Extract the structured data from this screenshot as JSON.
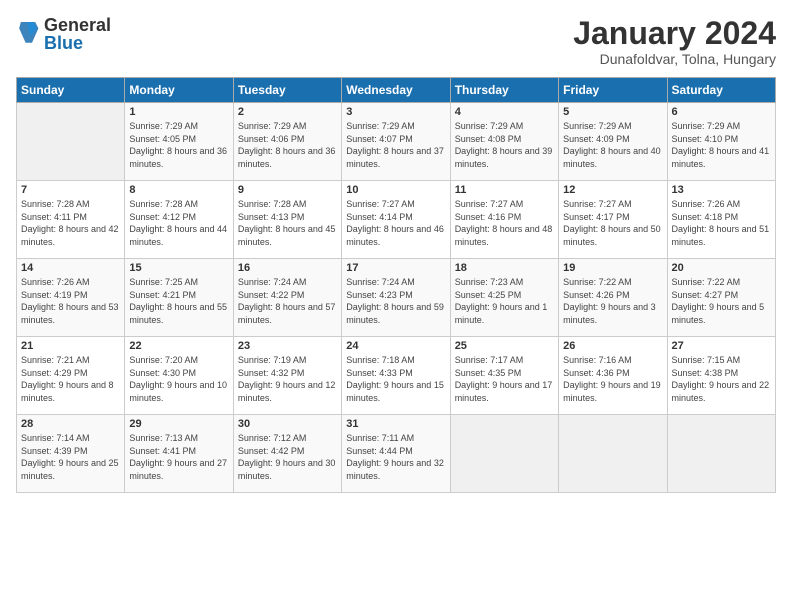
{
  "header": {
    "logo_general": "General",
    "logo_blue": "Blue",
    "month_title": "January 2024",
    "subtitle": "Dunafoldvar, Tolna, Hungary"
  },
  "weekdays": [
    "Sunday",
    "Monday",
    "Tuesday",
    "Wednesday",
    "Thursday",
    "Friday",
    "Saturday"
  ],
  "weeks": [
    [
      {
        "day": "",
        "sunrise": "",
        "sunset": "",
        "daylight": ""
      },
      {
        "day": "1",
        "sunrise": "Sunrise: 7:29 AM",
        "sunset": "Sunset: 4:05 PM",
        "daylight": "Daylight: 8 hours and 36 minutes."
      },
      {
        "day": "2",
        "sunrise": "Sunrise: 7:29 AM",
        "sunset": "Sunset: 4:06 PM",
        "daylight": "Daylight: 8 hours and 36 minutes."
      },
      {
        "day": "3",
        "sunrise": "Sunrise: 7:29 AM",
        "sunset": "Sunset: 4:07 PM",
        "daylight": "Daylight: 8 hours and 37 minutes."
      },
      {
        "day": "4",
        "sunrise": "Sunrise: 7:29 AM",
        "sunset": "Sunset: 4:08 PM",
        "daylight": "Daylight: 8 hours and 39 minutes."
      },
      {
        "day": "5",
        "sunrise": "Sunrise: 7:29 AM",
        "sunset": "Sunset: 4:09 PM",
        "daylight": "Daylight: 8 hours and 40 minutes."
      },
      {
        "day": "6",
        "sunrise": "Sunrise: 7:29 AM",
        "sunset": "Sunset: 4:10 PM",
        "daylight": "Daylight: 8 hours and 41 minutes."
      }
    ],
    [
      {
        "day": "7",
        "sunrise": "Sunrise: 7:28 AM",
        "sunset": "Sunset: 4:11 PM",
        "daylight": "Daylight: 8 hours and 42 minutes."
      },
      {
        "day": "8",
        "sunrise": "Sunrise: 7:28 AM",
        "sunset": "Sunset: 4:12 PM",
        "daylight": "Daylight: 8 hours and 44 minutes."
      },
      {
        "day": "9",
        "sunrise": "Sunrise: 7:28 AM",
        "sunset": "Sunset: 4:13 PM",
        "daylight": "Daylight: 8 hours and 45 minutes."
      },
      {
        "day": "10",
        "sunrise": "Sunrise: 7:27 AM",
        "sunset": "Sunset: 4:14 PM",
        "daylight": "Daylight: 8 hours and 46 minutes."
      },
      {
        "day": "11",
        "sunrise": "Sunrise: 7:27 AM",
        "sunset": "Sunset: 4:16 PM",
        "daylight": "Daylight: 8 hours and 48 minutes."
      },
      {
        "day": "12",
        "sunrise": "Sunrise: 7:27 AM",
        "sunset": "Sunset: 4:17 PM",
        "daylight": "Daylight: 8 hours and 50 minutes."
      },
      {
        "day": "13",
        "sunrise": "Sunrise: 7:26 AM",
        "sunset": "Sunset: 4:18 PM",
        "daylight": "Daylight: 8 hours and 51 minutes."
      }
    ],
    [
      {
        "day": "14",
        "sunrise": "Sunrise: 7:26 AM",
        "sunset": "Sunset: 4:19 PM",
        "daylight": "Daylight: 8 hours and 53 minutes."
      },
      {
        "day": "15",
        "sunrise": "Sunrise: 7:25 AM",
        "sunset": "Sunset: 4:21 PM",
        "daylight": "Daylight: 8 hours and 55 minutes."
      },
      {
        "day": "16",
        "sunrise": "Sunrise: 7:24 AM",
        "sunset": "Sunset: 4:22 PM",
        "daylight": "Daylight: 8 hours and 57 minutes."
      },
      {
        "day": "17",
        "sunrise": "Sunrise: 7:24 AM",
        "sunset": "Sunset: 4:23 PM",
        "daylight": "Daylight: 8 hours and 59 minutes."
      },
      {
        "day": "18",
        "sunrise": "Sunrise: 7:23 AM",
        "sunset": "Sunset: 4:25 PM",
        "daylight": "Daylight: 9 hours and 1 minute."
      },
      {
        "day": "19",
        "sunrise": "Sunrise: 7:22 AM",
        "sunset": "Sunset: 4:26 PM",
        "daylight": "Daylight: 9 hours and 3 minutes."
      },
      {
        "day": "20",
        "sunrise": "Sunrise: 7:22 AM",
        "sunset": "Sunset: 4:27 PM",
        "daylight": "Daylight: 9 hours and 5 minutes."
      }
    ],
    [
      {
        "day": "21",
        "sunrise": "Sunrise: 7:21 AM",
        "sunset": "Sunset: 4:29 PM",
        "daylight": "Daylight: 9 hours and 8 minutes."
      },
      {
        "day": "22",
        "sunrise": "Sunrise: 7:20 AM",
        "sunset": "Sunset: 4:30 PM",
        "daylight": "Daylight: 9 hours and 10 minutes."
      },
      {
        "day": "23",
        "sunrise": "Sunrise: 7:19 AM",
        "sunset": "Sunset: 4:32 PM",
        "daylight": "Daylight: 9 hours and 12 minutes."
      },
      {
        "day": "24",
        "sunrise": "Sunrise: 7:18 AM",
        "sunset": "Sunset: 4:33 PM",
        "daylight": "Daylight: 9 hours and 15 minutes."
      },
      {
        "day": "25",
        "sunrise": "Sunrise: 7:17 AM",
        "sunset": "Sunset: 4:35 PM",
        "daylight": "Daylight: 9 hours and 17 minutes."
      },
      {
        "day": "26",
        "sunrise": "Sunrise: 7:16 AM",
        "sunset": "Sunset: 4:36 PM",
        "daylight": "Daylight: 9 hours and 19 minutes."
      },
      {
        "day": "27",
        "sunrise": "Sunrise: 7:15 AM",
        "sunset": "Sunset: 4:38 PM",
        "daylight": "Daylight: 9 hours and 22 minutes."
      }
    ],
    [
      {
        "day": "28",
        "sunrise": "Sunrise: 7:14 AM",
        "sunset": "Sunset: 4:39 PM",
        "daylight": "Daylight: 9 hours and 25 minutes."
      },
      {
        "day": "29",
        "sunrise": "Sunrise: 7:13 AM",
        "sunset": "Sunset: 4:41 PM",
        "daylight": "Daylight: 9 hours and 27 minutes."
      },
      {
        "day": "30",
        "sunrise": "Sunrise: 7:12 AM",
        "sunset": "Sunset: 4:42 PM",
        "daylight": "Daylight: 9 hours and 30 minutes."
      },
      {
        "day": "31",
        "sunrise": "Sunrise: 7:11 AM",
        "sunset": "Sunset: 4:44 PM",
        "daylight": "Daylight: 9 hours and 32 minutes."
      },
      {
        "day": "",
        "sunrise": "",
        "sunset": "",
        "daylight": ""
      },
      {
        "day": "",
        "sunrise": "",
        "sunset": "",
        "daylight": ""
      },
      {
        "day": "",
        "sunrise": "",
        "sunset": "",
        "daylight": ""
      }
    ]
  ]
}
